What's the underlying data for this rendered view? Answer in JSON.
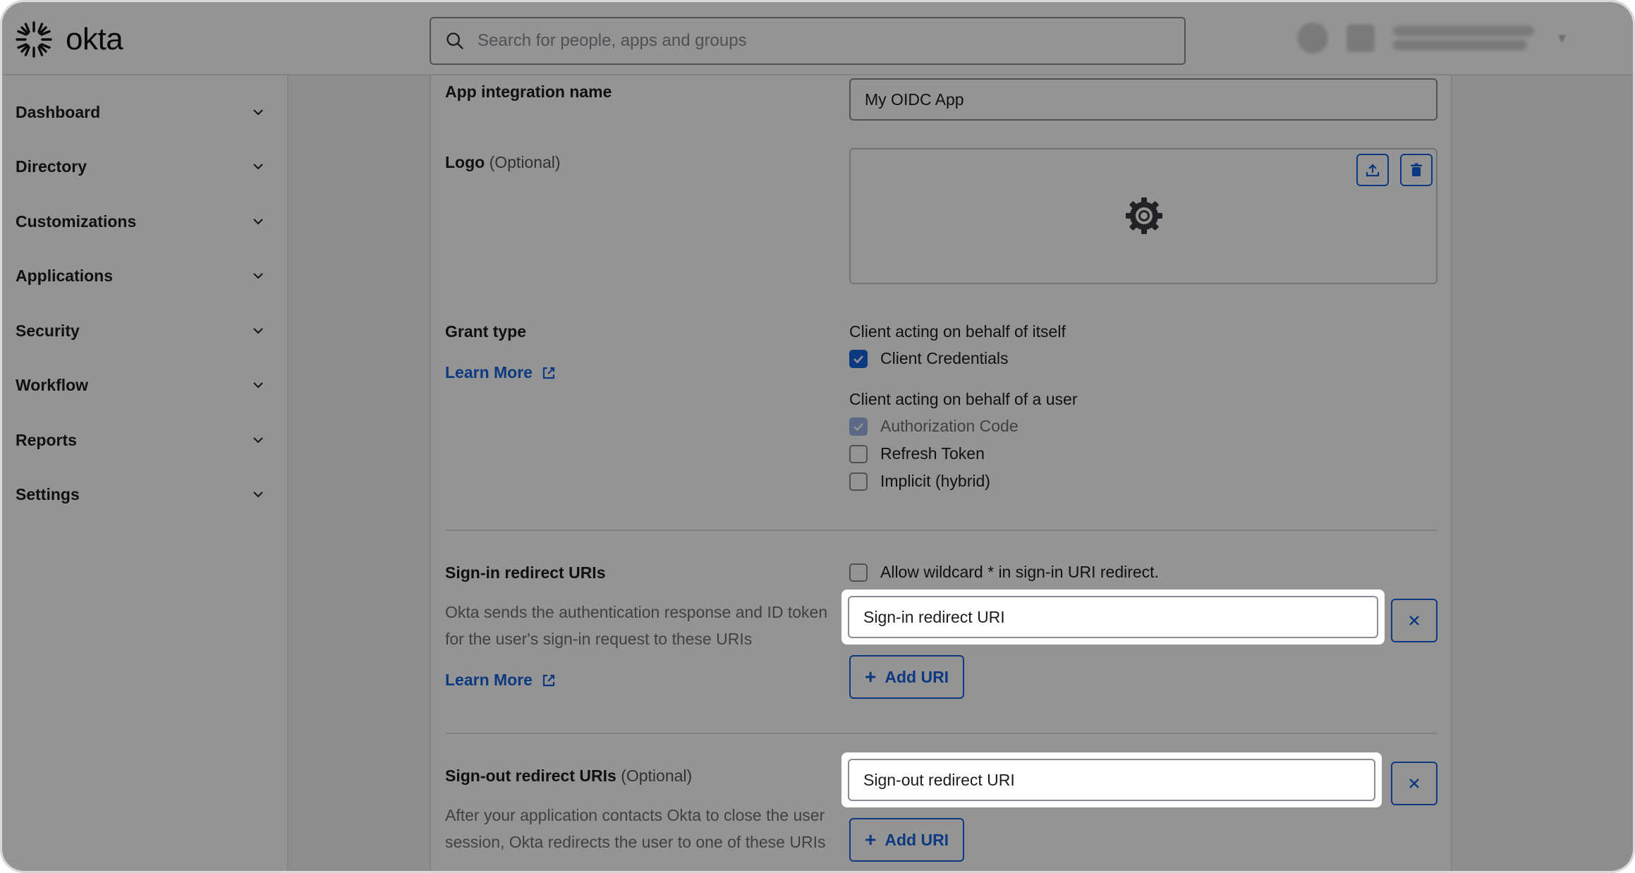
{
  "app": {
    "brand": "okta"
  },
  "search": {
    "placeholder": "Search for people, apps and groups"
  },
  "sidebar": {
    "items": [
      {
        "label": "Dashboard"
      },
      {
        "label": "Directory"
      },
      {
        "label": "Customizations"
      },
      {
        "label": "Applications"
      },
      {
        "label": "Security"
      },
      {
        "label": "Workflow"
      },
      {
        "label": "Reports"
      },
      {
        "label": "Settings"
      }
    ]
  },
  "form": {
    "app_name": {
      "label": "App integration name",
      "value": "My OIDC App"
    },
    "logo": {
      "label": "Logo",
      "optional": "(Optional)"
    },
    "grant_type": {
      "label": "Grant type",
      "learn_more": "Learn More",
      "self_heading": "Client acting on behalf of itself",
      "user_heading": "Client acting on behalf of a user",
      "options": [
        {
          "label": "Client Credentials",
          "checked": true
        },
        {
          "label": "Authorization Code",
          "checked": true,
          "disabled": true
        },
        {
          "label": "Refresh Token",
          "checked": false
        },
        {
          "label": "Implicit (hybrid)",
          "checked": false
        }
      ]
    },
    "signin": {
      "label": "Sign-in redirect URIs",
      "description": "Okta sends the authentication response and ID token for the user's sign-in request to these URIs",
      "learn_more": "Learn More",
      "wildcard_label": "Allow wildcard * in sign-in URI redirect.",
      "uri_value": "Sign-in redirect URI",
      "add_label": "Add URI"
    },
    "signout": {
      "label": "Sign-out redirect URIs",
      "optional": "(Optional)",
      "description": "After your application contacts Okta to close the user session, Okta redirects the user to one of these URIs",
      "uri_value": "Sign-out redirect URI",
      "add_label": "Add URI"
    }
  },
  "colors": {
    "accent": "#1662dd",
    "overlay": "rgba(0,0,0,0.42)"
  }
}
